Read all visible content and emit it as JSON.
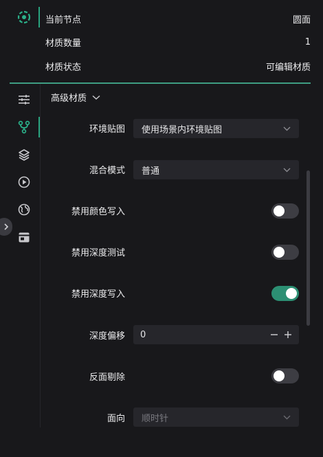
{
  "info": {
    "rows": [
      {
        "label": "当前节点",
        "value": "圆面"
      },
      {
        "label": "材质数量",
        "value": "1"
      },
      {
        "label": "材质状态",
        "value": "可编辑材质"
      }
    ]
  },
  "rail": {
    "icons": [
      "settings-sliders-icon",
      "branch-icon",
      "layers-icon",
      "play-circle-icon",
      "globe-icon",
      "calendar-icon"
    ],
    "active": "branch-icon"
  },
  "section": {
    "title": "高级材质"
  },
  "props": {
    "env_map": {
      "label": "环境贴图",
      "value": "使用场景内环境贴图"
    },
    "blend_mode": {
      "label": "混合模式",
      "value": "普通"
    },
    "disable_color_write": {
      "label": "禁用颜色写入",
      "on": false
    },
    "disable_depth_test": {
      "label": "禁用深度测试",
      "on": false
    },
    "disable_depth_write": {
      "label": "禁用深度写入",
      "on": true
    },
    "depth_offset": {
      "label": "深度偏移",
      "value": "0"
    },
    "backface_cull": {
      "label": "反面剔除",
      "on": false
    },
    "face_direction": {
      "label": "面向",
      "value": "顺时针"
    }
  },
  "colors": {
    "accent": "#29a37e",
    "toggle_on": "#2c8f73",
    "background": "#18181b",
    "field": "#26262b"
  }
}
